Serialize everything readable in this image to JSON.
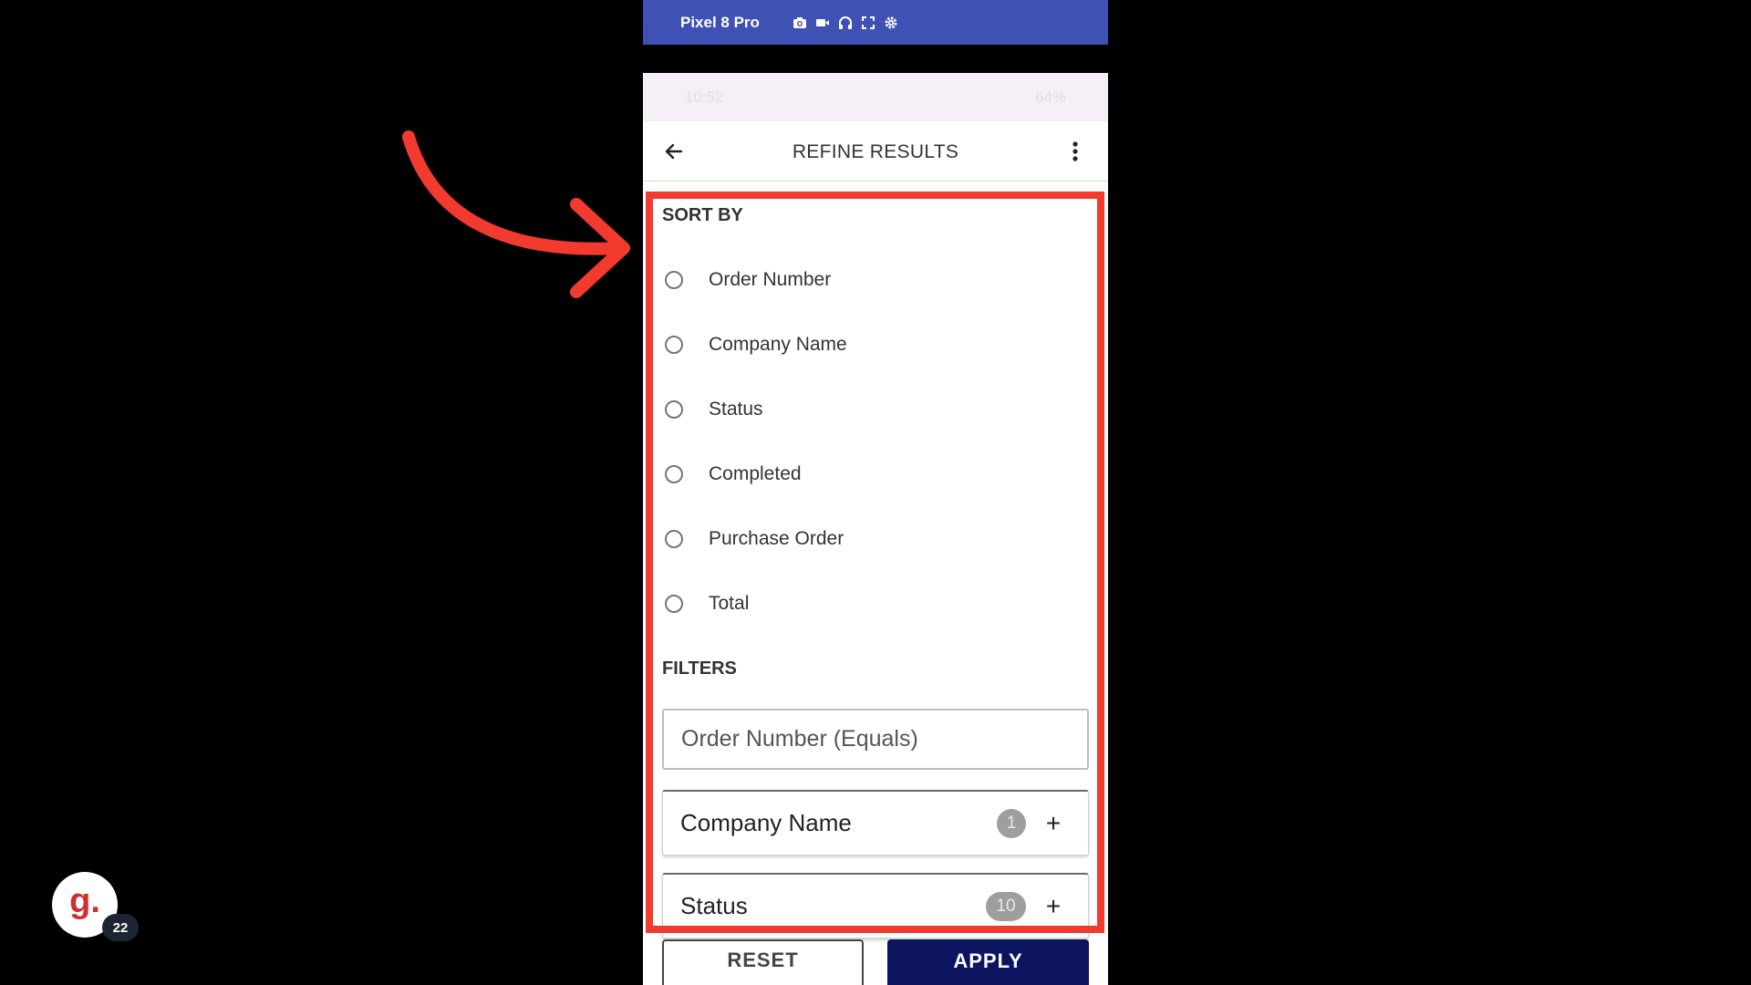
{
  "emulator": {
    "device_name": "Pixel 8 Pro",
    "icons": [
      "camera-icon",
      "video-icon",
      "headset-icon",
      "fullscreen-icon",
      "settings-icon"
    ],
    "bar_color": "#3F51B5"
  },
  "status_bar": {
    "time": "10:52",
    "battery": "64%"
  },
  "app_bar": {
    "title": "REFINE RESULTS",
    "back_icon": "arrow-left-icon",
    "menu_icon": "more-vert-icon"
  },
  "sort_by": {
    "heading": "SORT BY",
    "options": [
      {
        "label": "Order Number"
      },
      {
        "label": "Company Name"
      },
      {
        "label": "Status"
      },
      {
        "label": "Completed"
      },
      {
        "label": "Purchase Order"
      },
      {
        "label": "Total"
      }
    ]
  },
  "filters": {
    "heading": "FILTERS",
    "order_number_placeholder": "Order Number (Equals)",
    "items": [
      {
        "label": "Company Name",
        "count": "1",
        "action": "+"
      },
      {
        "label": "Status",
        "count": "10",
        "action": "+"
      }
    ]
  },
  "actions": {
    "reset_label": "RESET",
    "apply_label": "APPLY",
    "apply_color": "#0D1560"
  },
  "annotation": {
    "highlight_color": "#F23A2E"
  },
  "overlay": {
    "avatar_letter": "g.",
    "badge_count": "22"
  }
}
